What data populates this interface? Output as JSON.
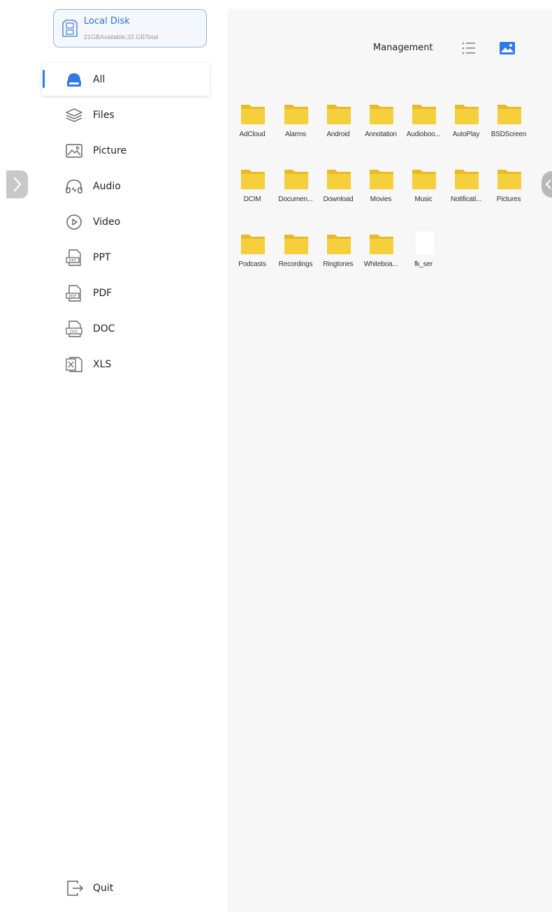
{
  "storage": {
    "name": "Local Disk",
    "capacity": "21GBAvailable,32.GBTotal"
  },
  "nav": {
    "items": [
      {
        "label": "All",
        "icon": "cloud-drive-icon",
        "active": true
      },
      {
        "label": "Files",
        "icon": "layers-icon"
      },
      {
        "label": "Picture",
        "icon": "picture-icon"
      },
      {
        "label": "Audio",
        "icon": "headphones-icon"
      },
      {
        "label": "Video",
        "icon": "play-circle-icon"
      },
      {
        "label": "PPT",
        "icon": "ppt-file-icon"
      },
      {
        "label": "PDF",
        "icon": "pdf-file-icon"
      },
      {
        "label": "DOC",
        "icon": "doc-file-icon"
      },
      {
        "label": "XLS",
        "icon": "xls-file-icon"
      }
    ],
    "quit_label": "Quit"
  },
  "toolbar": {
    "management_label": "Management",
    "list_view_icon": "list-icon",
    "grid_view_icon": "image-icon"
  },
  "files": {
    "rows": [
      [
        "AdCloud",
        "Alarms",
        "Android",
        "Annotation",
        "Audioboo...",
        "AutoPlay",
        "BSDScreen"
      ],
      [
        "DCIM",
        "Documen...",
        "Download",
        "Movies",
        "Music",
        "Notificati...",
        "Pictures"
      ],
      [
        "Podcasts",
        "Recordings",
        "Ringtones",
        "Whiteboa...",
        "fk_ser"
      ]
    ],
    "blank_file": "fk_ser"
  },
  "colors": {
    "accent": "#2f7ae5",
    "folder": "#f5cf3c",
    "panel_bg": "#f7f7f7"
  }
}
